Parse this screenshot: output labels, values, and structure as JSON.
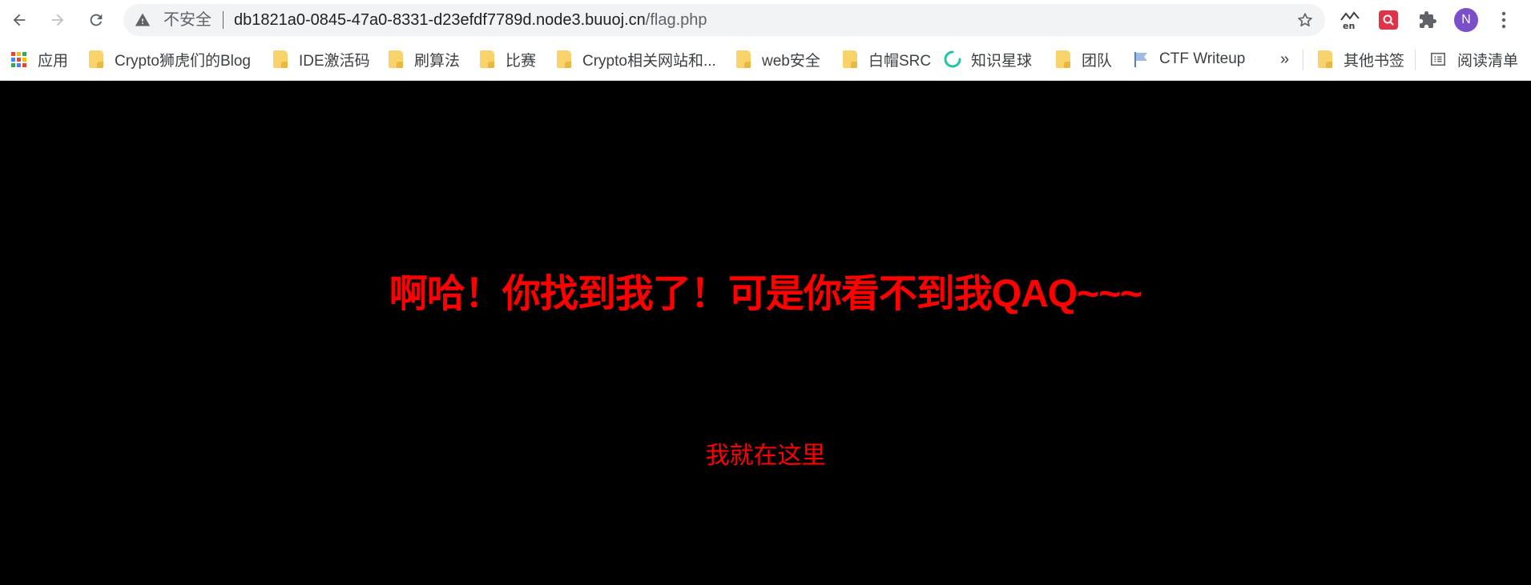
{
  "browser": {
    "security_label": "不安全",
    "url_host": "db1821a0-0845-47a0-8331-d23efdf7789d.node3.buuoj.cn",
    "url_path": "/flag.php",
    "avatar_letter": "N",
    "translate_ext_label": "en",
    "icons": {
      "back": "arrow-left-icon",
      "forward": "arrow-right-icon",
      "reload": "reload-icon",
      "warning": "warning-triangle-icon",
      "star": "star-icon",
      "translate": "translate-icon",
      "search_ext": "search-icon",
      "extensions": "puzzle-icon",
      "menu": "more-vert-icon"
    }
  },
  "bookmarks": {
    "apps_label": "应用",
    "items": [
      {
        "label": "Crypto狮虎们的Blog",
        "icon": "folder-icon"
      },
      {
        "label": "IDE激活码",
        "icon": "folder-icon"
      },
      {
        "label": "刷算法",
        "icon": "folder-icon"
      },
      {
        "label": "比赛",
        "icon": "folder-icon"
      },
      {
        "label": "Crypto相关网站和...",
        "icon": "folder-icon"
      },
      {
        "label": "web安全",
        "icon": "folder-icon"
      },
      {
        "label": "白帽SRC",
        "icon": "folder-icon"
      },
      {
        "label": "知识星球",
        "icon": "refresh-circle-icon"
      },
      {
        "label": "团队",
        "icon": "folder-icon"
      },
      {
        "label": "CTF Writeup",
        "icon": "flag-icon"
      }
    ],
    "overflow_label": "»",
    "other_bookmarks_label": "其他书签",
    "reading_list_label": "阅读清单"
  },
  "page": {
    "headline": "啊哈！你找到我了！可是你看不到我QAQ~~~",
    "subline": "我就在这里",
    "background_color": "#000000",
    "text_color": "#ff0000"
  },
  "colors": {
    "folder": "#f8d36b",
    "avatar": "#7b4fc9",
    "search_ext": "#e0334a"
  }
}
